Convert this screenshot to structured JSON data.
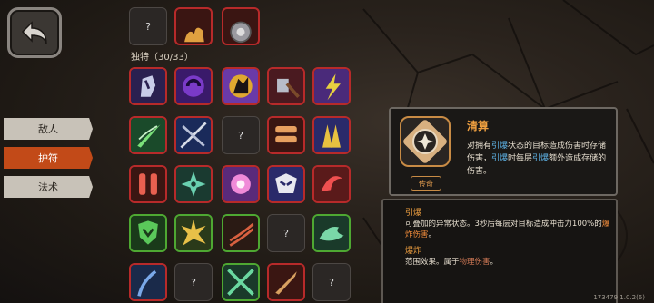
{
  "section": {
    "title": "独特（30/33）"
  },
  "tabs": [
    {
      "label": "敌人",
      "active": false
    },
    {
      "label": "护符",
      "active": true
    },
    {
      "label": "法术",
      "active": false
    }
  ],
  "grid": {
    "unknown_label": "?",
    "cells": [
      [
        "purple-ghost",
        "purple-swirl",
        "purple-wolf",
        "purple-axe",
        "purple-lightning"
      ],
      [
        "green-slash",
        "blue-blades",
        "empty",
        "red-bullets",
        "purple-spikes"
      ],
      [
        "red-bullets2",
        "green-shuriken",
        "pink-flower",
        "blue-mask",
        "red-swirl"
      ],
      [
        "green-shield",
        "green-explosion",
        "red-claw",
        "empty",
        "green-dragon"
      ],
      [
        "blue-claw",
        "empty",
        "green-cross",
        "red-knife",
        "empty"
      ]
    ]
  },
  "detail": {
    "title": "清算",
    "description_prefix": "对拥有",
    "kw1": "引爆",
    "description_mid": "状态的目标造成伤害时存储伤害，",
    "kw2": "引爆",
    "description_mid2": "时每层",
    "kw3": "引爆",
    "description_end": "额外造成存储的伤害。",
    "rarity": "传奇"
  },
  "keywords": [
    {
      "title": "引爆",
      "text_prefix": "可叠加的异常状态。3秒后每层对目标造成冲击力100%的",
      "text_highlight": "爆炸伤害",
      "text_suffix": "。"
    },
    {
      "title": "爆炸",
      "text_prefix": "范围效果。属于",
      "text_highlight": "物理伤害",
      "text_suffix": "。"
    }
  ],
  "version": "173479 1.0.2(6)"
}
